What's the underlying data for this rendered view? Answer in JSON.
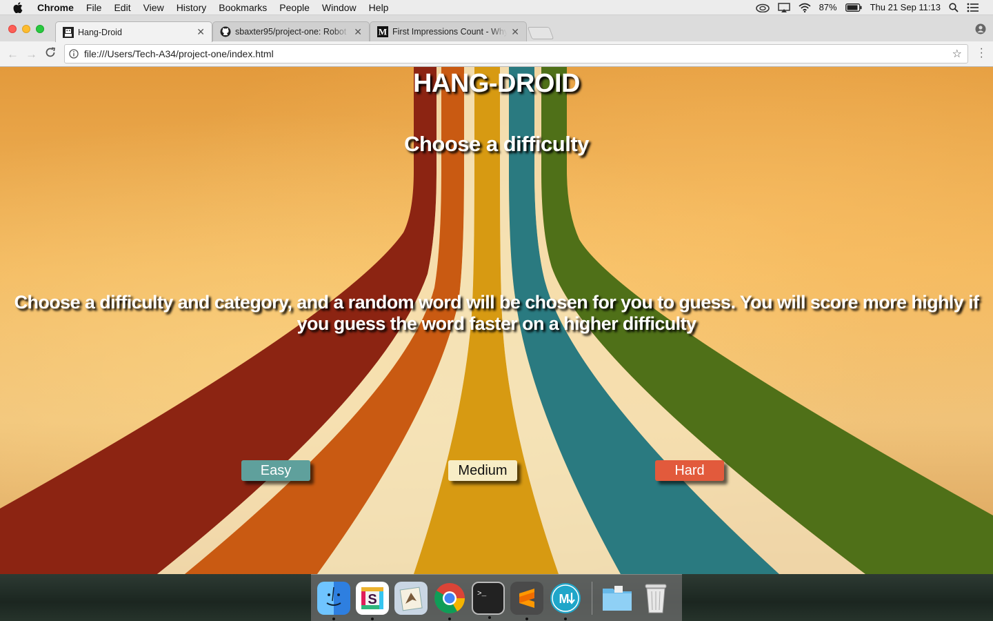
{
  "menubar": {
    "app_name": "Chrome",
    "items": [
      "File",
      "Edit",
      "View",
      "History",
      "Bookmarks",
      "People",
      "Window",
      "Help"
    ],
    "battery": "87%",
    "datetime": "Thu 21 Sep  11:13"
  },
  "tabs": [
    {
      "title": "Hang-Droid",
      "active": true
    },
    {
      "title": "sbaxter95/project-one: Robot",
      "active": false
    },
    {
      "title": "First Impressions Count - Why",
      "active": false
    }
  ],
  "toolbar": {
    "url": "file:///Users/Tech-A34/project-one/index.html"
  },
  "page": {
    "title": "HANG-DROID",
    "subtitle": "Choose a difficulty",
    "intro": "Choose a difficulty and category, and a random word will be chosen for you to guess. You will score more highly if you guess the word faster on a higher difficulty",
    "buttons": {
      "easy": "Easy",
      "medium": "Medium",
      "hard": "Hard"
    }
  },
  "colors": {
    "easy": "#5fa09c",
    "medium": "#f7edc6",
    "hard": "#e25a3c"
  },
  "dock": {
    "apps": [
      "finder-icon",
      "slack-icon",
      "mail-icon",
      "chrome-icon",
      "terminal-icon",
      "sublime-text-icon",
      "markdown-editor-icon"
    ],
    "others": [
      "downloads-folder-icon",
      "trash-icon"
    ]
  }
}
